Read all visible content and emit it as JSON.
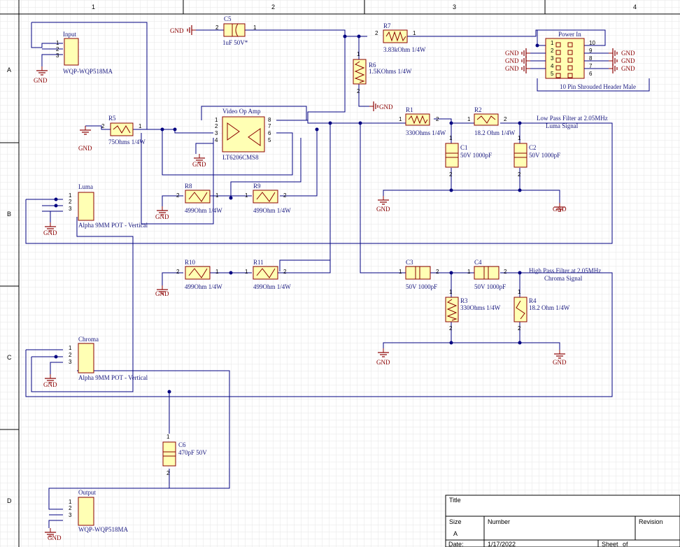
{
  "zones": {
    "columns": [
      "1",
      "2",
      "3",
      "4"
    ],
    "rows": [
      "A",
      "B",
      "C",
      "D"
    ]
  },
  "gnd_label": "GND",
  "colors": {
    "wire": "#000080",
    "component_fill": "#ffffb4",
    "component_stroke": "#8b0000",
    "ground": "#8b0000",
    "grid": "#e6e6e6",
    "text": "#1a1a80"
  },
  "components": {
    "input": {
      "ref": "Input",
      "value": "WQP-WQP518MA",
      "pins": [
        "1",
        "2",
        "3"
      ]
    },
    "luma": {
      "ref": "Luma",
      "value": "Alpha 9MM POT - Vertical",
      "pins": [
        "1",
        "2",
        "3"
      ]
    },
    "chroma": {
      "ref": "Chroma",
      "value": "Alpha 9MM POT - Vertical",
      "pins": [
        "1",
        "2",
        "3"
      ]
    },
    "output": {
      "ref": "Output",
      "value": "WQP-WQP518MA",
      "pins": [
        "1",
        "2",
        "3"
      ]
    },
    "c5": {
      "ref": "C5",
      "value": "1uF 50V*",
      "pins": [
        "2",
        "1"
      ]
    },
    "r7": {
      "ref": "R7",
      "value": "3.83kOhm 1/4W",
      "pins": [
        "2",
        "1"
      ]
    },
    "r6": {
      "ref": "R6",
      "value": "1.5KOhms 1/4W",
      "pins": [
        "1",
        "2"
      ]
    },
    "r5": {
      "ref": "R5",
      "value": "75Ohms 1/4W",
      "pins": [
        "2",
        "1"
      ]
    },
    "opamp": {
      "ref": "Video Op Amp",
      "value": "LT6206CMS8",
      "pins_left": [
        "1",
        "2",
        "3",
        "4"
      ],
      "pins_right": [
        "8",
        "7",
        "6",
        "5"
      ]
    },
    "power": {
      "ref": "Power In",
      "value": "10 Pin Shrouded Header Male",
      "pins_left": [
        "1",
        "2",
        "3",
        "4",
        "5"
      ],
      "pins_right": [
        "10",
        "9",
        "8",
        "7",
        "6"
      ]
    },
    "r1": {
      "ref": "R1",
      "value": "330Ohms 1/4W",
      "pins": [
        "1",
        "2"
      ]
    },
    "r2": {
      "ref": "R2",
      "value": "18.2 Ohm 1/4W",
      "pins": [
        "1",
        "2"
      ]
    },
    "c1": {
      "ref": "C1",
      "value": "50V 1000pF",
      "pins": [
        "1",
        "2"
      ]
    },
    "c2": {
      "ref": "C2",
      "value": "50V 1000pF",
      "pins": [
        "1",
        "2"
      ]
    },
    "r8": {
      "ref": "R8",
      "value": "499Ohm 1/4W",
      "pins": [
        "2",
        "1"
      ]
    },
    "r9": {
      "ref": "R9",
      "value": "499Ohm 1/4W",
      "pins": [
        "1",
        "2"
      ]
    },
    "r10": {
      "ref": "R10",
      "value": "499Ohm 1/4W",
      "pins": [
        "2",
        "1"
      ]
    },
    "r11": {
      "ref": "R11",
      "value": "499Ohm 1/4W",
      "pins": [
        "1",
        "2"
      ]
    },
    "c3": {
      "ref": "C3",
      "value": "50V 1000pF",
      "pins": [
        "1",
        "2"
      ]
    },
    "c4": {
      "ref": "C4",
      "value": "50V 1000pF",
      "pins": [
        "1",
        "2"
      ]
    },
    "r3": {
      "ref": "R3",
      "value": "330Ohms 1/4W",
      "pins": [
        "1",
        "2"
      ]
    },
    "r4": {
      "ref": "R4",
      "value": "18.2 Ohm 1/4W",
      "pins": [
        "1",
        "2"
      ]
    },
    "c6": {
      "ref": "C6",
      "value": "470pF 50V",
      "pins": [
        "1",
        "2"
      ]
    }
  },
  "annotations": {
    "lowpass": "Low Pass Filter at 2.05MHz",
    "luma_signal": "Luma Signal",
    "highpass": "High Pass Filter at 2.05MHz",
    "chroma_signal": "Chroma Signal"
  },
  "title_block": {
    "title": "Title",
    "size_label": "Size",
    "size_value": "A",
    "number_label": "Number",
    "revision_label": "Revision",
    "date_label": "Date:",
    "date_value": "1/17/2022",
    "sheet_label": "Sheet",
    "of_label": "of"
  }
}
